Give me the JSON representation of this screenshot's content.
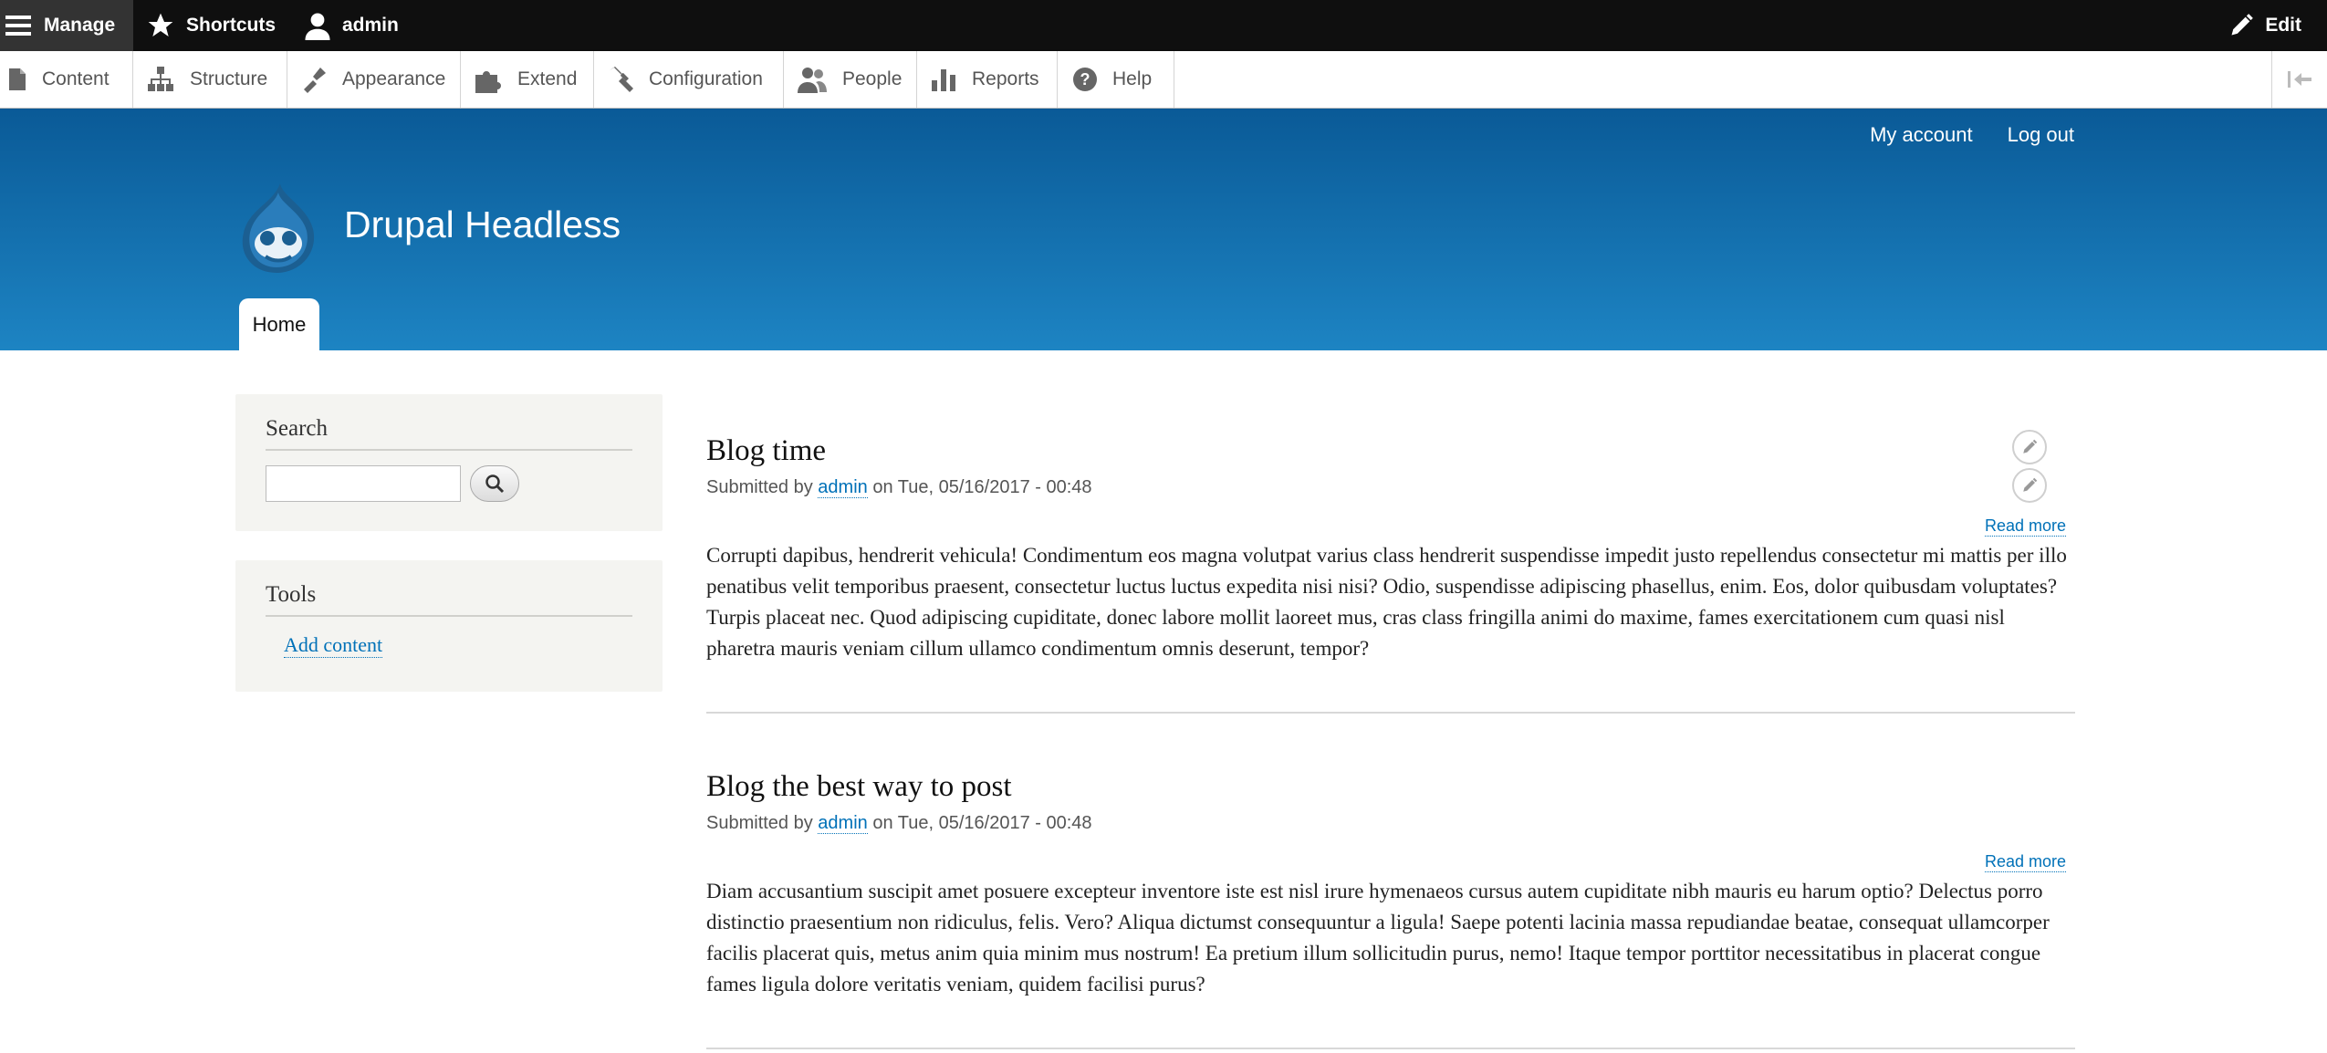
{
  "toolbar": {
    "manage": "Manage",
    "shortcuts": "Shortcuts",
    "user": "admin",
    "edit": "Edit"
  },
  "tray": {
    "items": [
      {
        "label": "Content",
        "icon": "document-icon"
      },
      {
        "label": "Structure",
        "icon": "structure-icon"
      },
      {
        "label": "Appearance",
        "icon": "paintbrush-icon"
      },
      {
        "label": "Extend",
        "icon": "puzzle-icon"
      },
      {
        "label": "Configuration",
        "icon": "wrench-icon"
      },
      {
        "label": "People",
        "icon": "people-icon"
      },
      {
        "label": "Reports",
        "icon": "bar-chart-icon"
      },
      {
        "label": "Help",
        "icon": "help-icon"
      }
    ]
  },
  "header": {
    "site_name": "Drupal Headless",
    "account_links": [
      "My account",
      "Log out"
    ],
    "primary_tab": "Home"
  },
  "sidebar": {
    "search_title": "Search",
    "search_value": "",
    "tools_title": "Tools",
    "tools_link": "Add content"
  },
  "articles": [
    {
      "title": "Blog time",
      "submitted_prefix": "Submitted by",
      "author": "admin",
      "date": "on Tue, 05/16/2017 - 00:48",
      "read_more": "Read more",
      "body": "Corrupti dapibus, hendrerit vehicula! Condimentum eos magna volutpat varius class hendrerit suspendisse impedit justo repellendus consectetur mi mattis per illo penatibus velit temporibus praesent, consectetur luctus luctus expedita nisi nisi? Odio, suspendisse adipiscing phasellus, enim. Eos, dolor quibusdam voluptates? Turpis placeat nec. Quod adipiscing cupiditate, donec labore mollit laoreet mus, cras class fringilla animi do maxime, fames exercitationem cum quasi nisl pharetra mauris veniam cillum ullamco condimentum omnis deserunt, tempor?"
    },
    {
      "title": "Blog the best way to post",
      "submitted_prefix": "Submitted by",
      "author": "admin",
      "date": "on Tue, 05/16/2017 - 00:48",
      "read_more": "Read more",
      "body": "Diam accusantium suscipit amet posuere excepteur inventore iste est nisl irure hymenaeos cursus autem cupiditate nibh mauris eu harum optio? Delectus porro distinctio praesentium non ridiculus, felis. Vero? Aliqua dictumst consequuntur a ligula! Saepe potenti lacinia massa repudiandae beatae, consequat ullamcorper facilis placerat quis, metus anim quia minim mus nostrum! Ea pretium illum sollicitudin purus, nemo! Itaque tempor porttitor necessitatibus in placerat congue fames ligula dolore veritatis veniam, quidem facilisi purus?"
    }
  ]
}
